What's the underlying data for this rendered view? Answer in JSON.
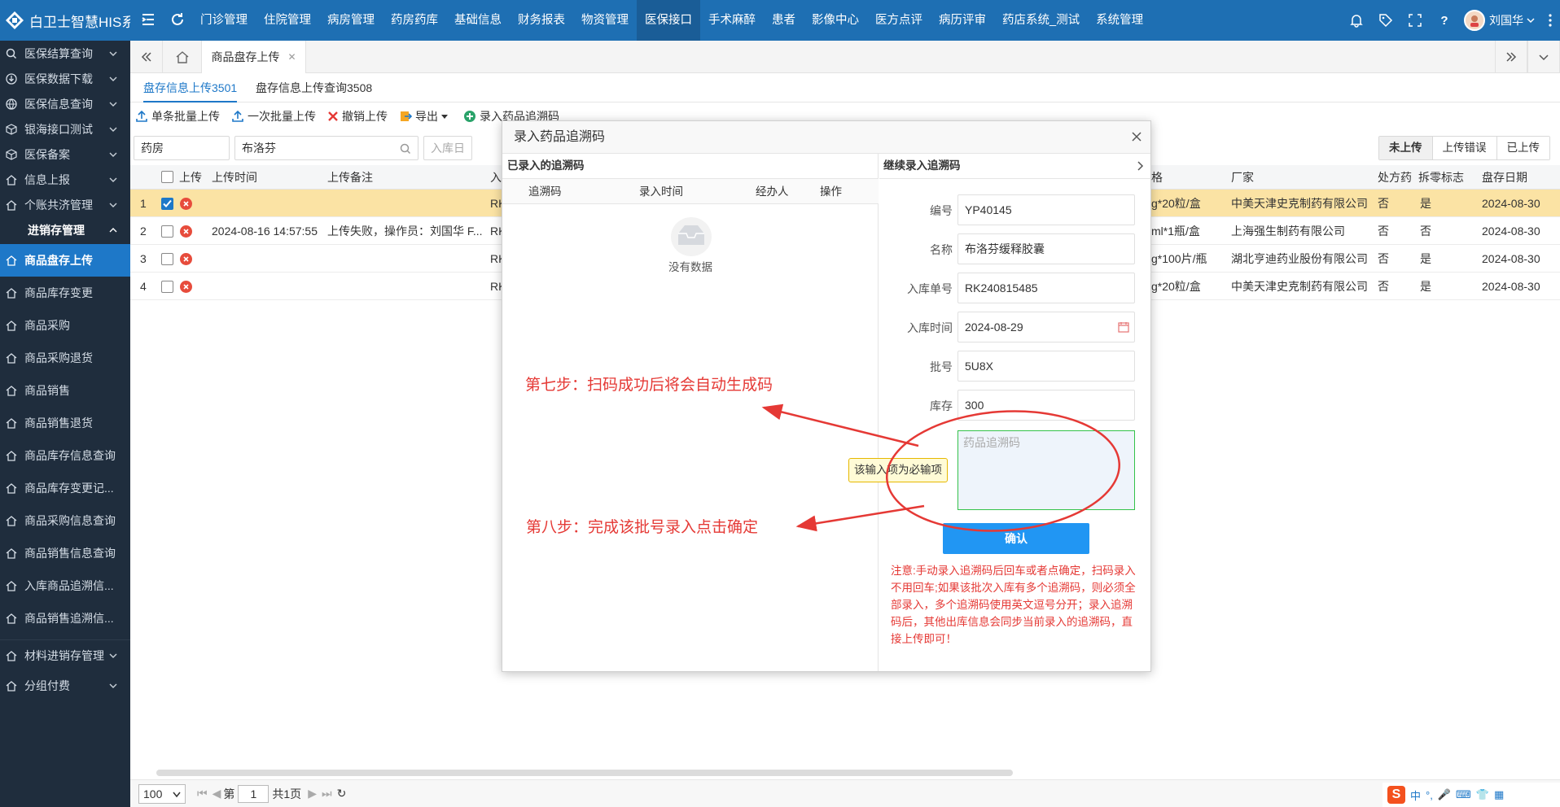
{
  "app": {
    "brand": "白卫士智慧HIS系统",
    "user_name": "刘国华"
  },
  "topnav": [
    "门诊管理",
    "住院管理",
    "病房管理",
    "药房药库",
    "基础信息",
    "财务报表",
    "物资管理",
    "医保接口",
    "手术麻醉",
    "患者",
    "影像中心",
    "医方点评",
    "病历评审",
    "药店系统_测试",
    "系统管理"
  ],
  "topnav_active": "医保接口",
  "sidebar": {
    "groups_before": [
      {
        "label": "医保结算查询",
        "icon": "search-icon"
      },
      {
        "label": "医保数据下载",
        "icon": "download-icon"
      },
      {
        "label": "医保信息查询",
        "icon": "globe-icon"
      },
      {
        "label": "银海接口测试",
        "icon": "cube-icon"
      },
      {
        "label": "医保备案",
        "icon": "cube-icon"
      },
      {
        "label": "信息上报",
        "icon": "home-icon"
      },
      {
        "label": "个账共济管理",
        "icon": "home-icon"
      }
    ],
    "open_group": "进销存管理",
    "sub_items": [
      "商品盘存上传",
      "商品库存变更",
      "商品采购",
      "商品采购退货",
      "商品销售",
      "商品销售退货",
      "商品库存信息查询",
      "商品库存变更记...",
      "商品采购信息查询",
      "商品销售信息查询",
      "入库商品追溯信...",
      "商品销售追溯信..."
    ],
    "active_sub": "商品盘存上传",
    "groups_after": [
      {
        "label": "材料进销存管理",
        "icon": "home-icon"
      },
      {
        "label": "分组付费",
        "icon": "home-icon"
      }
    ]
  },
  "page_tab": {
    "label": "商品盘存上传"
  },
  "sub_tabs": [
    "盘存信息上传3501",
    "盘存信息上传查询3508"
  ],
  "toolbar": {
    "single_batch": "单条批量上传",
    "all_batch": "一次批量上传",
    "cancel": "撤销上传",
    "export": "导出",
    "add_trace": "录入药品追溯码"
  },
  "filters": {
    "pharmacy": "药房",
    "drug": "布洛芬",
    "date_placeholder": "入库日"
  },
  "status_buttons": [
    "未上传",
    "上传错误",
    "已上传"
  ],
  "status_active": "未上传",
  "table": {
    "headers": {
      "upload": "上传",
      "upload_time": "上传时间",
      "upload_note": "上传备注",
      "in_no": "入",
      "spec": "格",
      "maker": "厂家",
      "rx": "处方药",
      "split": "拆零标志",
      "stock_date": "盘存日期"
    },
    "rows": [
      {
        "no": "1",
        "checked": true,
        "time": "",
        "note": "",
        "in": "RK",
        "spec": "g*20粒/盒",
        "maker": "中美天津史克制药有限公司",
        "rx": "否",
        "split": "是",
        "date": "2024-08-30"
      },
      {
        "no": "2",
        "checked": false,
        "time": "2024-08-16 14:57:55",
        "note": "上传失败，操作员：刘国华 F...",
        "in": "RK",
        "spec": "ml*1瓶/盒",
        "maker": "上海强生制药有限公司",
        "rx": "否",
        "split": "否",
        "date": "2024-08-30"
      },
      {
        "no": "3",
        "checked": false,
        "time": "",
        "note": "",
        "in": "RK",
        "spec": "g*100片/瓶",
        "maker": "湖北亨迪药业股份有限公司",
        "rx": "否",
        "split": "是",
        "date": "2024-08-30"
      },
      {
        "no": "4",
        "checked": false,
        "time": "",
        "note": "",
        "in": "RK",
        "spec": "g*20粒/盒",
        "maker": "中美天津史克制药有限公司",
        "rx": "否",
        "split": "是",
        "date": "2024-08-30"
      }
    ]
  },
  "pager": {
    "page_size": "100",
    "page_label": "第",
    "page": "1",
    "total": "共1页"
  },
  "modal": {
    "title": "录入药品追溯码",
    "left_title": "已录入的追溯码",
    "left_cols": [
      "追溯码",
      "录入时间",
      "经办人",
      "操作"
    ],
    "empty_text": "没有数据",
    "right_title": "继续录入追溯码",
    "fields": [
      {
        "label": "编号",
        "value": "YP40145"
      },
      {
        "label": "名称",
        "value": "布洛芬缓释胶囊"
      },
      {
        "label": "入库单号",
        "value": "RK240815485"
      },
      {
        "label": "入库时间",
        "value": "2024-08-29"
      },
      {
        "label": "批号",
        "value": "5U8X"
      },
      {
        "label": "库存",
        "value": "300"
      }
    ],
    "trace_placeholder": "药品追溯码",
    "required_tip": "该输入项为必输项",
    "confirm": "确认",
    "note": "注意:手动录入追溯码后回车或者点确定，扫码录入不用回车;如果该批次入库有多个追溯码，则必须全部录入，多个追溯码使用英文逗号分开；录入追溯码后，其他出库信息会同步当前录入的追溯码，直接上传即可！"
  },
  "annotations": {
    "step7": "第七步：扫码成功后将会自动生成码",
    "step8": "第八步：完成该批号录入点击确定"
  },
  "ime": {
    "label": "中"
  },
  "colors": {
    "primary": "#1e6fb3",
    "sidebar": "#1f2d3d",
    "active": "#1e78c8",
    "annotation": "#e53935",
    "selected_row": "#fbe3a4"
  }
}
